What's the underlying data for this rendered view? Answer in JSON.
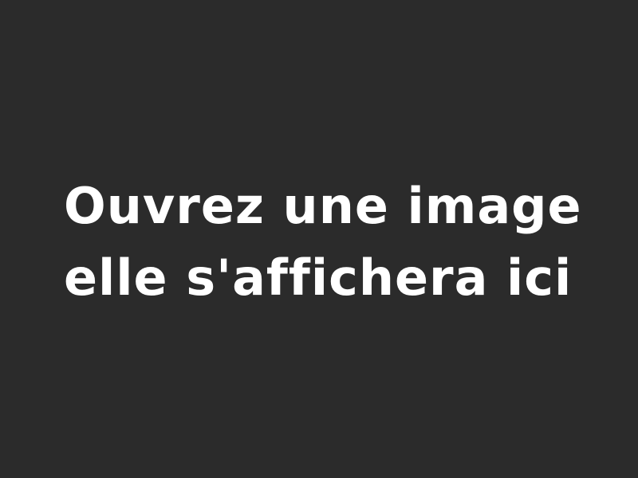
{
  "viewer": {
    "background_color": "#2b2b2b",
    "text_color": "#ffffff",
    "placeholder_lines": [
      "Ouvrez une image",
      "elle s'affichera ici"
    ]
  }
}
